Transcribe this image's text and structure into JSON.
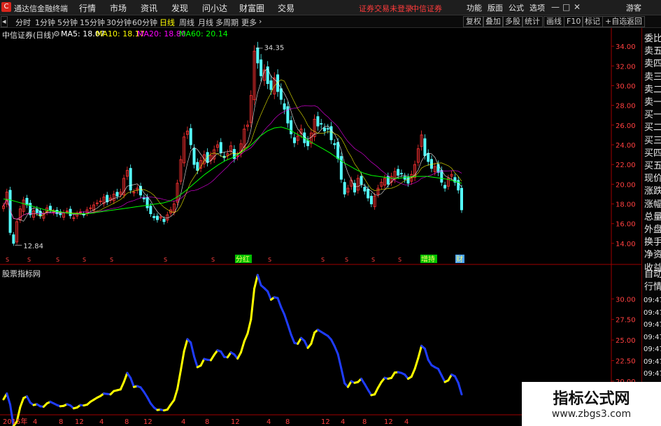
{
  "app": {
    "title": "通达信金融终端",
    "logo": "C"
  },
  "menu": [
    "行情",
    "市场",
    "资讯",
    "发现",
    "问小达",
    "财富圈",
    "交易"
  ],
  "login_status": "证券交易未登录",
  "broker": "中信证券",
  "topright": [
    "功能",
    "版面",
    "公式",
    "选项"
  ],
  "user": "游客",
  "window_buttons": [
    "—",
    "□",
    "✕"
  ],
  "periods": [
    "分时",
    "1分钟",
    "5分钟",
    "15分钟",
    "30分钟",
    "60分钟",
    "日线",
    "周线",
    "月线",
    "多周期",
    "更多"
  ],
  "active_period": "日线",
  "toolbar_right": [
    "复权",
    "叠加",
    "多股",
    "统计",
    "画线",
    "F10",
    "标记",
    "+自选",
    "返回"
  ],
  "legend": {
    "stock": "中信证券(日线)",
    "ma5": "MA5: 18.07",
    "ma10": "MA10: 18.17",
    "ma20": "MA20: 18.80",
    "ma60": "MA60: 20.14"
  },
  "colors": {
    "ma5": "#ffffff",
    "ma10": "#ffff00",
    "ma20": "#ff00ff",
    "ma60": "#00ff00",
    "up": "#ff3232",
    "down": "#54ffff",
    "axis": "#a00000",
    "indicator_up": "#ffff00",
    "indicator_down": "#1f3cff"
  },
  "chart_data": [
    {
      "type": "candlestick",
      "y_ticks": [
        "34.00",
        "32.00",
        "30.00",
        "28.00",
        "26.00",
        "24.00",
        "22.00",
        "20.00",
        "18.00",
        "16.00",
        "14.00"
      ],
      "ylim": [
        13.0,
        35.0
      ],
      "high_label": "34.35",
      "low_label": "12.84",
      "close": [
        17.8,
        19.2,
        15.1,
        14.0,
        16.2,
        17.5,
        18.4,
        17.9,
        16.9,
        17.3,
        17.1,
        16.8,
        17.0,
        17.6,
        17.4,
        17.2,
        17.0,
        16.9,
        17.1,
        17.3,
        16.8,
        16.6,
        17.0,
        17.2,
        16.9,
        17.4,
        17.6,
        17.9,
        18.1,
        18.3,
        18.7,
        18.2,
        18.6,
        19.0,
        18.8,
        19.2,
        20.6,
        21.4,
        19.4,
        19.2,
        19.6,
        18.9,
        18.5,
        17.6,
        17.0,
        16.6,
        16.4,
        16.7,
        16.2,
        16.9,
        17.4,
        18.0,
        20.1,
        22.5,
        24.8,
        25.4,
        24.0,
        22.0,
        21.4,
        22.4,
        23.0,
        22.2,
        22.9,
        23.5,
        24.0,
        23.2,
        22.7,
        23.1,
        23.9,
        22.6,
        22.9,
        24.1,
        25.6,
        26.0,
        29.0,
        33.5,
        32.3,
        31.0,
        31.6,
        30.2,
        29.6,
        30.8,
        29.4,
        28.6,
        27.6,
        26.2,
        25.1,
        24.2,
        24.9,
        25.6,
        24.2,
        23.9,
        25.2,
        26.6,
        25.9,
        26.1,
        25.4,
        25.6,
        24.5,
        24.0,
        22.6,
        20.5,
        19.0,
        19.6,
        20.4,
        19.2,
        20.6,
        20.0,
        19.3,
        18.6,
        18.0,
        18.8,
        19.6,
        20.2,
        20.6,
        20.0,
        20.8,
        21.3,
        20.9,
        21.1,
        20.5,
        20.1,
        21.0,
        22.0,
        23.6,
        25.0,
        22.9,
        22.3,
        21.6,
        21.8,
        21.2,
        20.2,
        19.6,
        20.6,
        21.0,
        20.2,
        19.4,
        17.4
      ],
      "ma60": [
        18.5,
        18.4,
        18.2,
        18.0,
        17.8,
        17.6,
        17.4,
        17.3,
        17.2,
        17.1,
        17.0,
        17.0,
        17.0,
        17.1,
        17.2,
        17.3,
        17.4,
        17.5,
        17.6,
        17.7,
        17.8,
        17.9,
        18.0,
        18.1,
        18.3,
        18.7,
        19.2,
        19.8,
        20.4,
        21.0,
        21.5,
        22.0,
        22.4,
        22.7,
        23.1,
        23.6,
        24.2,
        24.9,
        25.4,
        25.7,
        25.8,
        25.6,
        25.2,
        24.8,
        24.4,
        24.0,
        23.6,
        23.2,
        22.7,
        22.2,
        21.8,
        21.4,
        21.1,
        20.9,
        20.8,
        20.7,
        20.6,
        20.6,
        20.7,
        20.8,
        20.8,
        20.8,
        20.7,
        20.6,
        20.5,
        20.3,
        20.1
      ],
      "markers": [
        "S",
        "S",
        "S",
        "S",
        "S",
        "S",
        "S",
        "S",
        "S",
        "S",
        "S",
        "S",
        "S",
        "S",
        "S",
        "S"
      ],
      "badges": [
        {
          "label": "分红",
          "color": "#00c000"
        },
        {
          "label": "增持",
          "color": "#00c000"
        },
        {
          "label": "财",
          "color": "#4aa3ff"
        }
      ]
    },
    {
      "type": "line",
      "title": "股票指标网",
      "y_ticks": [
        "30.00",
        "27.50",
        "25.00",
        "22.50",
        "20.00",
        "17.50"
      ],
      "ylim": [
        16.0,
        33.0
      ],
      "x_ticks": [
        "2015年",
        "4",
        "8",
        "12",
        "4",
        "8",
        "12",
        "4",
        "8",
        "12",
        "4",
        "8",
        "12",
        "4",
        "8",
        "12",
        "4"
      ]
    }
  ],
  "side": {
    "labels": [
      "委比",
      "卖五",
      "卖四",
      "卖三",
      "卖二",
      "卖一",
      "买一",
      "买二",
      "买三",
      "买四",
      "买五",
      "现价",
      "涨跌",
      "涨幅",
      "总量",
      "外盘",
      "换手",
      "净资",
      "收益"
    ],
    "bottom": [
      "自动",
      "行情"
    ],
    "times": [
      "09:47",
      "09:47",
      "09:47",
      "09:47",
      "09:47",
      "09:47",
      "09:47",
      "09:47",
      "09:47",
      "09:47"
    ]
  },
  "watermark": {
    "title": "指标公式网",
    "url": "www.zbgs3.com"
  }
}
